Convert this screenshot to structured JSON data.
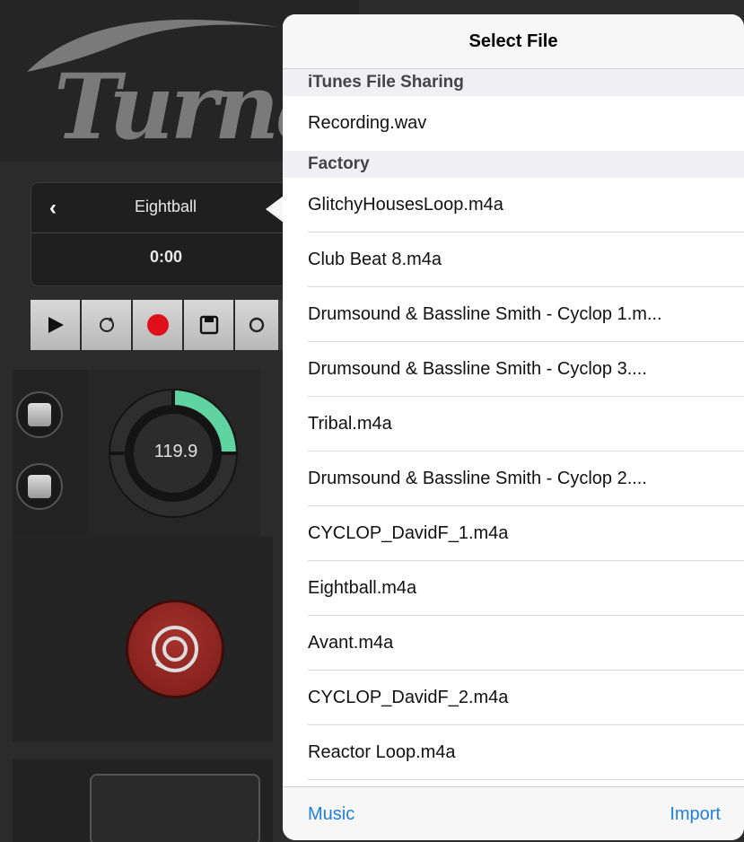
{
  "background": {
    "logo_text": "Turnad",
    "song": {
      "name": "Eightball",
      "time": "0:00"
    },
    "tempo": "119.9"
  },
  "popover": {
    "title": "Select File",
    "sections": [
      {
        "header": "iTunes File Sharing",
        "items": [
          "Recording.wav"
        ]
      },
      {
        "header": "Factory",
        "items": [
          "GlitchyHousesLoop.m4a",
          "Club Beat 8.m4a",
          "Drumsound & Bassline Smith - Cyclop 1.m...",
          "Drumsound & Bassline Smith - Cyclop 3....",
          "Tribal.m4a",
          "Drumsound & Bassline Smith - Cyclop 2....",
          "CYCLOP_DavidF_1.m4a",
          "Eightball.m4a",
          "Avant.m4a",
          "CYCLOP_DavidF_2.m4a",
          "Reactor Loop.m4a"
        ]
      }
    ],
    "footer": {
      "left": "Music",
      "right": "Import"
    }
  },
  "colors": {
    "accent": "#1f7fe0",
    "dial": "#5fd3a0",
    "record": "#e0101a"
  }
}
